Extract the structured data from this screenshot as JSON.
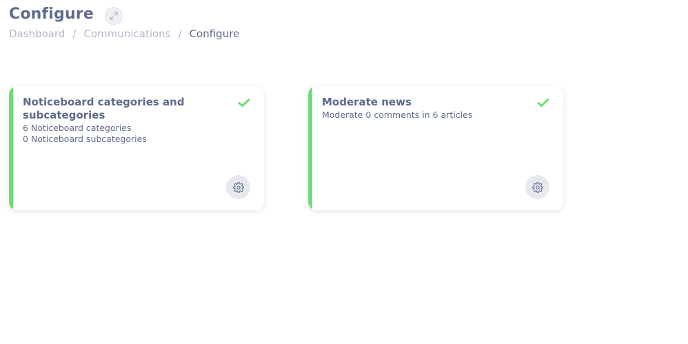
{
  "header": {
    "title": "Configure",
    "expand_icon": "expand-arrows-icon"
  },
  "breadcrumb": {
    "items": [
      "Dashboard",
      "Communications",
      "Configure"
    ],
    "separator": "/"
  },
  "cards": [
    {
      "title": "Noticeboard categories and subcategories",
      "lines": [
        "6 Noticeboard categories",
        "0 Noticeboard subcategories"
      ],
      "status_icon": "check-icon",
      "action_icon": "gear-icon"
    },
    {
      "title": "Moderate news",
      "lines": [
        "Moderate 0 comments in 6 articles"
      ],
      "status_icon": "check-icon",
      "action_icon": "gear-icon"
    }
  ],
  "colors": {
    "accent": "#6fdd7a",
    "text": "#5f6b8c",
    "muted": "#b3b8c8",
    "button_bg": "#e7e9ef"
  }
}
